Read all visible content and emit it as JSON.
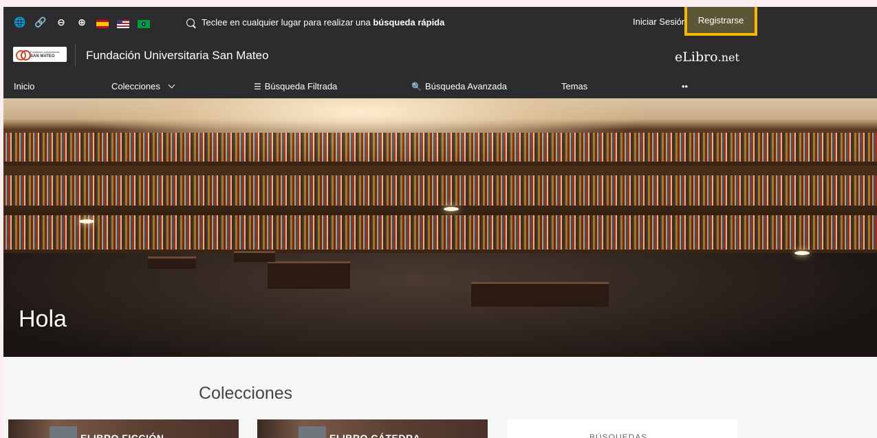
{
  "toolbar": {
    "icons": [
      "globe-icon",
      "link-icon",
      "zoom-out-icon",
      "zoom-in-icon",
      "flag-es-icon",
      "flag-us-icon",
      "flag-br-icon"
    ],
    "quick_search_prefix": "Teclee en cualquier lugar para realizar una ",
    "quick_search_bold": "búsqueda rápida",
    "login_label": "Iniciar Sesión",
    "register_label": "Registrarse",
    "highlight_color": "#f5b800"
  },
  "institution": {
    "logo_line1": "Fundación Universitaria",
    "logo_line2": "SAN MATEO",
    "name": "Fundación Universitaria San Mateo",
    "brand_main": "eLibro",
    "brand_suffix": ".net"
  },
  "nav": {
    "items": [
      {
        "label": "Inicio"
      },
      {
        "label": "Colecciones"
      },
      {
        "label": "Búsqueda Filtrada"
      },
      {
        "label": "Búsqueda Avanzada"
      },
      {
        "label": "Temas"
      },
      {
        "label": "••"
      }
    ]
  },
  "hero": {
    "title": "Hola"
  },
  "collections": {
    "heading": "Colecciones",
    "cards": [
      {
        "title": "ELIBRO FICCIÓN"
      },
      {
        "title": "ELIBRO CÁTEDRA"
      },
      {
        "title": "BÚSQUEDAS"
      }
    ]
  },
  "colors": {
    "header_bg": "#2c2c2e",
    "page_bg": "#f6f6f6"
  }
}
